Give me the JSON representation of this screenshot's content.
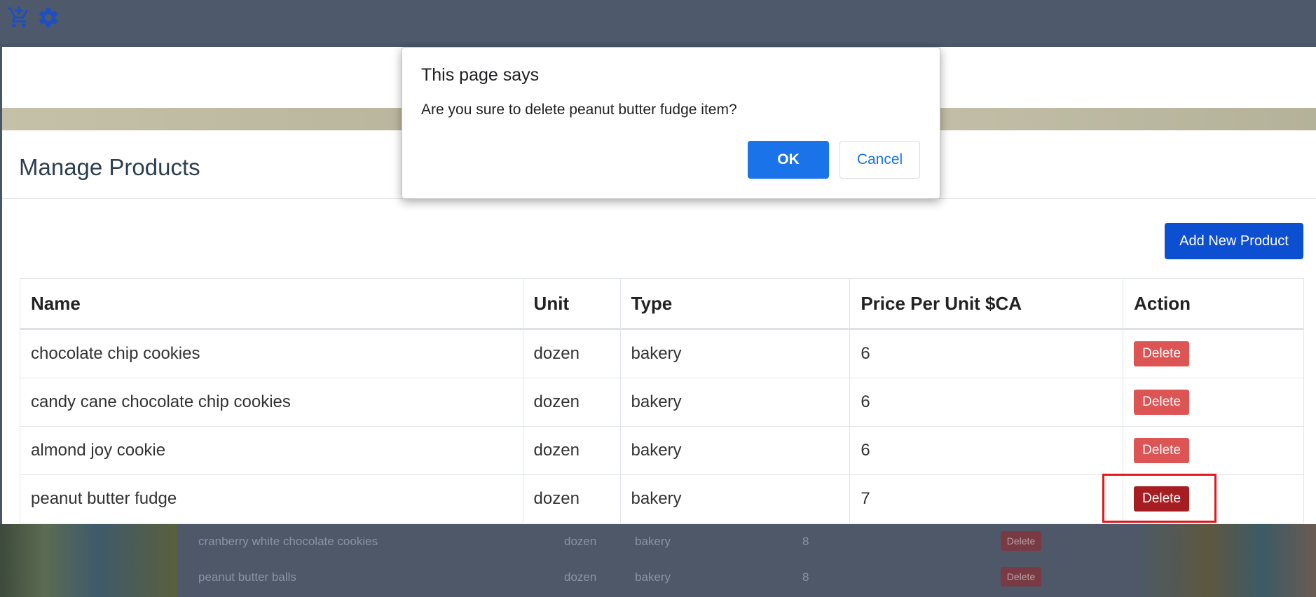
{
  "topbar": {
    "icons": [
      "cart-icon",
      "gear-icon"
    ],
    "color": "#1e4fc0"
  },
  "panel": {
    "title": "Manage Products",
    "add_button": "Add New Product",
    "table": {
      "headers": [
        "Name",
        "Unit",
        "Type",
        "Price Per Unit $CA",
        "Action"
      ],
      "rows": [
        {
          "name": "chocolate chip cookies",
          "unit": "dozen",
          "type": "bakery",
          "price": "6",
          "action": "Delete"
        },
        {
          "name": "candy cane chocolate chip cookies",
          "unit": "dozen",
          "type": "bakery",
          "price": "6",
          "action": "Delete"
        },
        {
          "name": "almond joy cookie",
          "unit": "dozen",
          "type": "bakery",
          "price": "6",
          "action": "Delete"
        },
        {
          "name": "peanut butter fudge",
          "unit": "dozen",
          "type": "bakery",
          "price": "7",
          "action": "Delete"
        }
      ]
    }
  },
  "background_rows": [
    {
      "name": "cranberry white chocolate cookies",
      "unit": "dozen",
      "type": "bakery",
      "price": "8",
      "action": "Delete"
    },
    {
      "name": "peanut butter balls",
      "unit": "dozen",
      "type": "bakery",
      "price": "8",
      "action": "Delete"
    }
  ],
  "dialog": {
    "title": "This page says",
    "message": "Are you sure to delete peanut butter fudge item?",
    "ok": "OK",
    "cancel": "Cancel"
  },
  "colors": {
    "accent": "#1a73e8",
    "add_button": "#0d4fd1",
    "delete": "#dc5454",
    "delete_active": "#a61e22",
    "highlight": "#e3191e"
  }
}
